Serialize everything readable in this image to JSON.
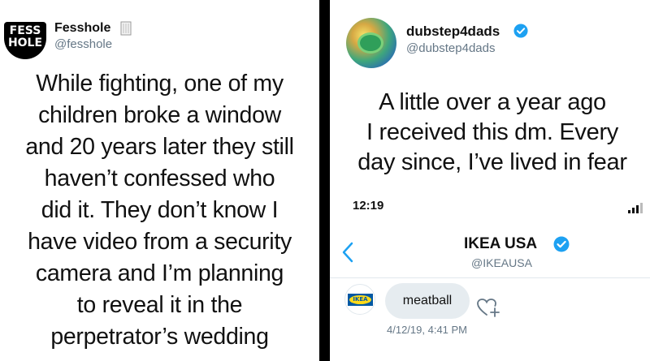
{
  "left_tweet": {
    "logo_lines": [
      "FESS",
      "HOLE"
    ],
    "display_name": "Fesshole",
    "handle": "@fesshole",
    "body_lines": [
      "While fighting, one of my",
      "children broke a window",
      "and 20 years later they still",
      "haven’t confessed who",
      "did it. They don’t know I",
      "have video from a security",
      "camera and I’m planning",
      "to reveal it in the",
      "perpetrator’s wedding"
    ]
  },
  "right_tweet": {
    "display_name": "dubstep4dads",
    "handle": "@dubstep4dads",
    "body_lines": [
      "A little over a year ago",
      "I received this dm. Every",
      "day since, I’ve lived in fear"
    ],
    "embedded_dm": {
      "status_time": "12:19",
      "contact_name": "IKEA USA",
      "contact_handle": "@IKEAUSA",
      "avatar_text": "IKEA",
      "message": "meatball",
      "message_time": "4/12/19, 4:41 PM"
    }
  },
  "colors": {
    "verified_blue": "#1da1f2",
    "link_blue": "#1da1f2",
    "secondary_text": "#657786",
    "bubble": "#e6ecf0",
    "ikea_blue": "#0058a3",
    "ikea_yellow": "#ffda1a"
  },
  "icons": {
    "bookmark": "bookmark-icon",
    "verified": "verified-badge-icon",
    "back": "chevron-left-icon",
    "react": "heart-plus-icon",
    "signal": "cell-signal-icon"
  }
}
